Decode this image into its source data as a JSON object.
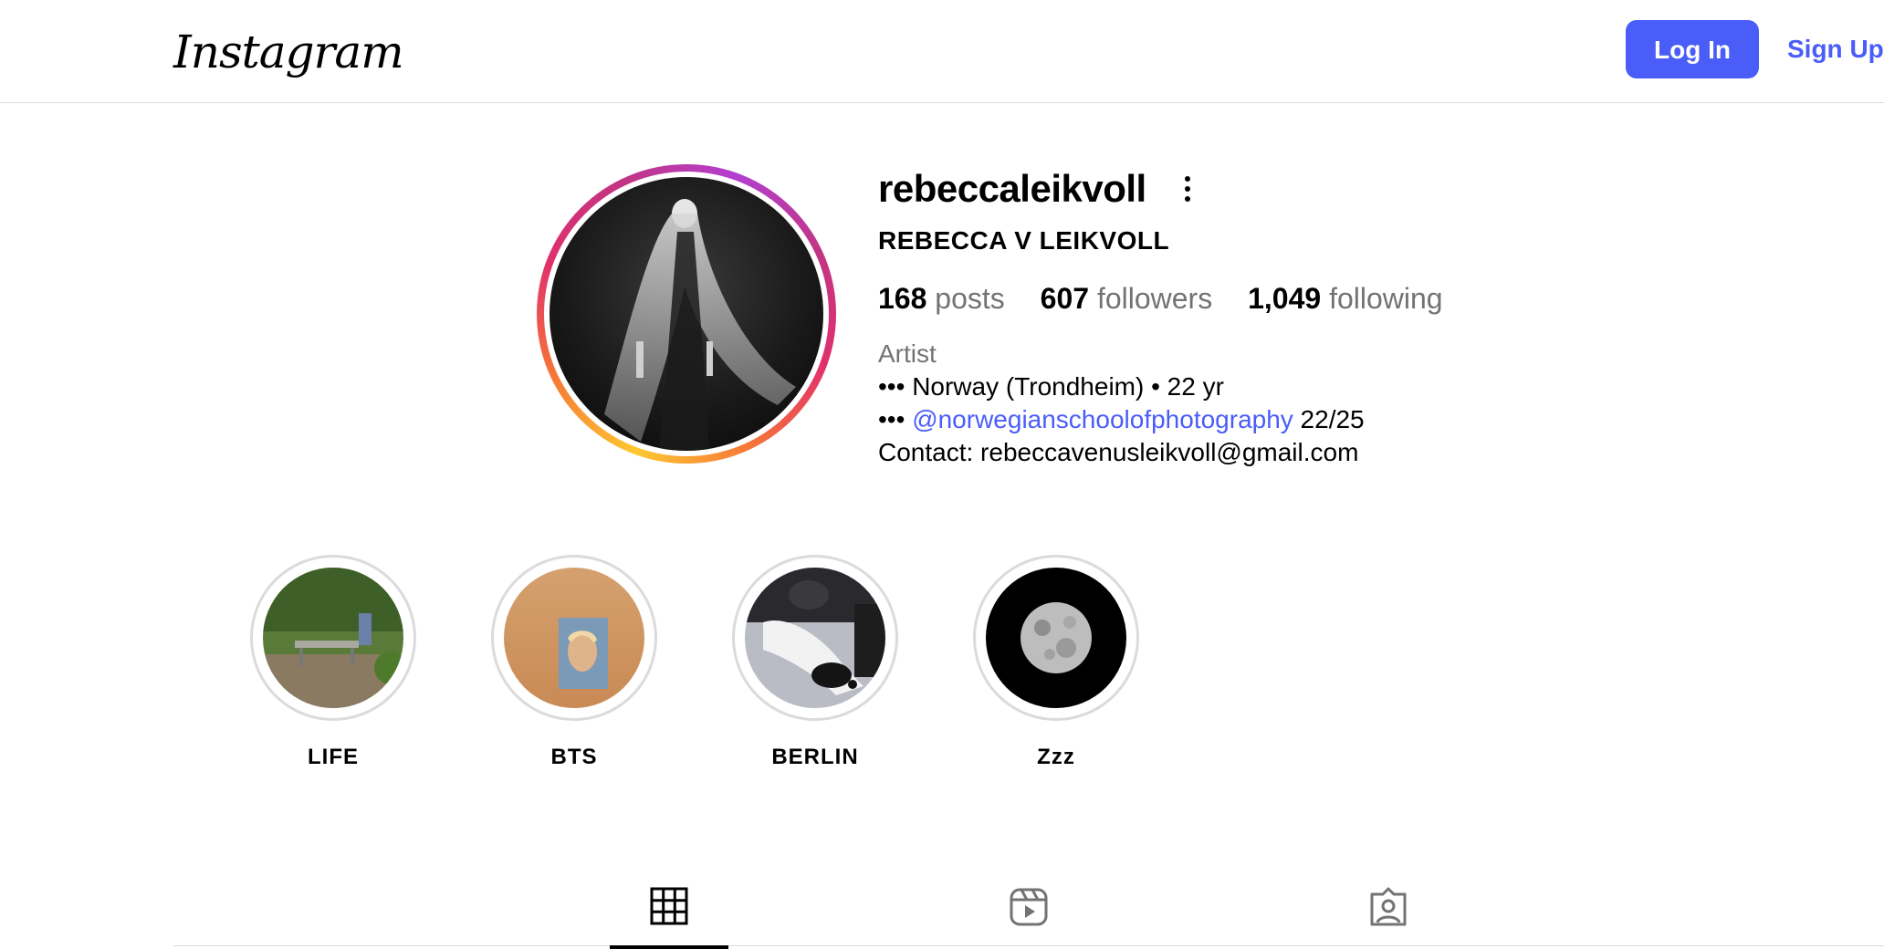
{
  "header": {
    "logo_text": "Instagram",
    "login_label": "Log In",
    "signup_label": "Sign Up",
    "accent_color": "#4a5df9"
  },
  "profile": {
    "username": "rebeccaleikvoll",
    "full_name": "REBECCA V LEIKVOLL",
    "stats": {
      "posts_count": "168",
      "posts_label": "posts",
      "followers_count": "607",
      "followers_label": "followers",
      "following_count": "1,049",
      "following_label": "following"
    },
    "category": "Artist",
    "bio": {
      "line1": "••• Norway (Trondheim) • 22 yr",
      "line2_prefix": "••• ",
      "line2_link": "@norwegianschoolofphotography",
      "line2_suffix": " 22/25",
      "line3": "Contact: rebeccavenusleikvoll@gmail.com"
    }
  },
  "highlights": [
    {
      "label": "LIFE"
    },
    {
      "label": "BTS"
    },
    {
      "label": "BERLIN"
    },
    {
      "label": "Zzz"
    }
  ],
  "tabs": [
    {
      "name": "posts-grid",
      "icon": "grid-icon",
      "active": true
    },
    {
      "name": "reels",
      "icon": "reels-icon",
      "active": false
    },
    {
      "name": "tagged",
      "icon": "tagged-icon",
      "active": false
    }
  ]
}
